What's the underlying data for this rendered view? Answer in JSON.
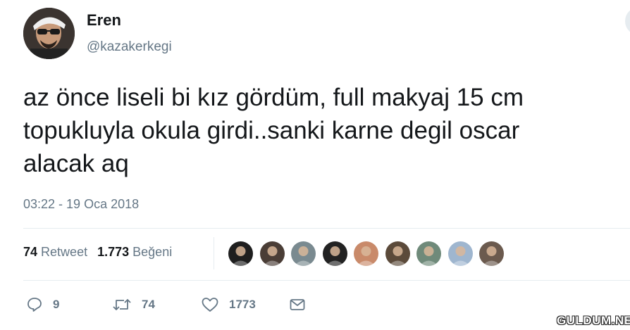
{
  "user": {
    "name": "Eren",
    "handle": "@kazakerkegi"
  },
  "tweet": {
    "lines": [
      "az önce liseli bi kız gördüm, full makyaj 15 cm",
      "topukluyla okula girdi..sanki karne degil oscar",
      "alacak aq"
    ],
    "timestamp": "03:22 - 19 Oca 2018"
  },
  "stats": {
    "retweets_count": "74",
    "retweets_label": "Retweet",
    "likes_count": "1.773",
    "likes_label": "Beğeni"
  },
  "likers": [
    {
      "icon": "liker-avatar",
      "color": "#1e1e1e"
    },
    {
      "icon": "liker-avatar",
      "color": "#4a3d36"
    },
    {
      "icon": "liker-avatar",
      "color": "#7a8a90"
    },
    {
      "icon": "liker-avatar",
      "color": "#222222"
    },
    {
      "icon": "liker-avatar",
      "color": "#c98a6a"
    },
    {
      "icon": "liker-avatar",
      "color": "#5b4a3a"
    },
    {
      "icon": "liker-avatar",
      "color": "#6f8a7a"
    },
    {
      "icon": "liker-avatar",
      "color": "#9fb6cf"
    },
    {
      "icon": "liker-avatar",
      "color": "#6b5a4e"
    }
  ],
  "actions": {
    "reply_count": "9",
    "retweet_count": "74",
    "like_count": "1773"
  },
  "watermark": "GULDUM.NET",
  "colors": {
    "text": "#14171a",
    "muted": "#657786",
    "divider": "#e6ecf0"
  }
}
